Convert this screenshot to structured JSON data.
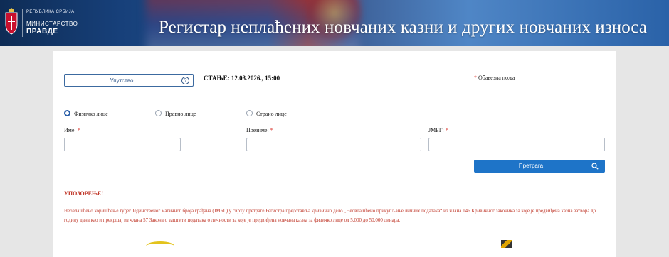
{
  "header": {
    "country": "РЕПУБЛИКА СРБИЈА",
    "ministry_line1": "МИНИСТАРСТВО",
    "ministry_line2": "ПРАВДЕ",
    "title": "Регистар неплаћених новчаних казни и других новчаних износа",
    "logo_icon": "coat-of-arms-icon"
  },
  "toolbar": {
    "instructions_label": "Упутство",
    "help_icon": "question-circle-icon",
    "status_text": "СТАЊЕ: 12.03.2026., 15:00",
    "required_note": "Обавезна поља",
    "required_mark": "*"
  },
  "person_type": {
    "options": [
      "Физичко лице",
      "Правно лице",
      "Страно лице"
    ],
    "selected": "Физичко лице"
  },
  "form": {
    "first_name_label": "Име:",
    "last_name_label": "Презиме:",
    "jmbg_label": "ЈМБГ:",
    "first_name_value": "",
    "last_name_value": "",
    "jmbg_value": ""
  },
  "search": {
    "label": "Претрага",
    "icon": "search-icon"
  },
  "warning": {
    "title": "УПОЗОРЕЊЕ!",
    "text": "Неовлашћено коришћење туђег Јединственог матичног броја грађана (ЈМБГ) у сврху претраге Регистра представља кривично дело „Неовлашћено прикупљање личних података“ из члана 146 Кривичног законика за које је предвиђена казна затвора до годину дана као и прекршај из члана 57 Закона о заштити података о личности за које је предвиђена новчана казна за физичко лице од 5.000 до 50.000 динара."
  },
  "colors": {
    "header_dark": "#0e2c55",
    "primary_button": "#1e74c8",
    "warning_red": "#c0392b",
    "required_red": "#d9322b"
  }
}
